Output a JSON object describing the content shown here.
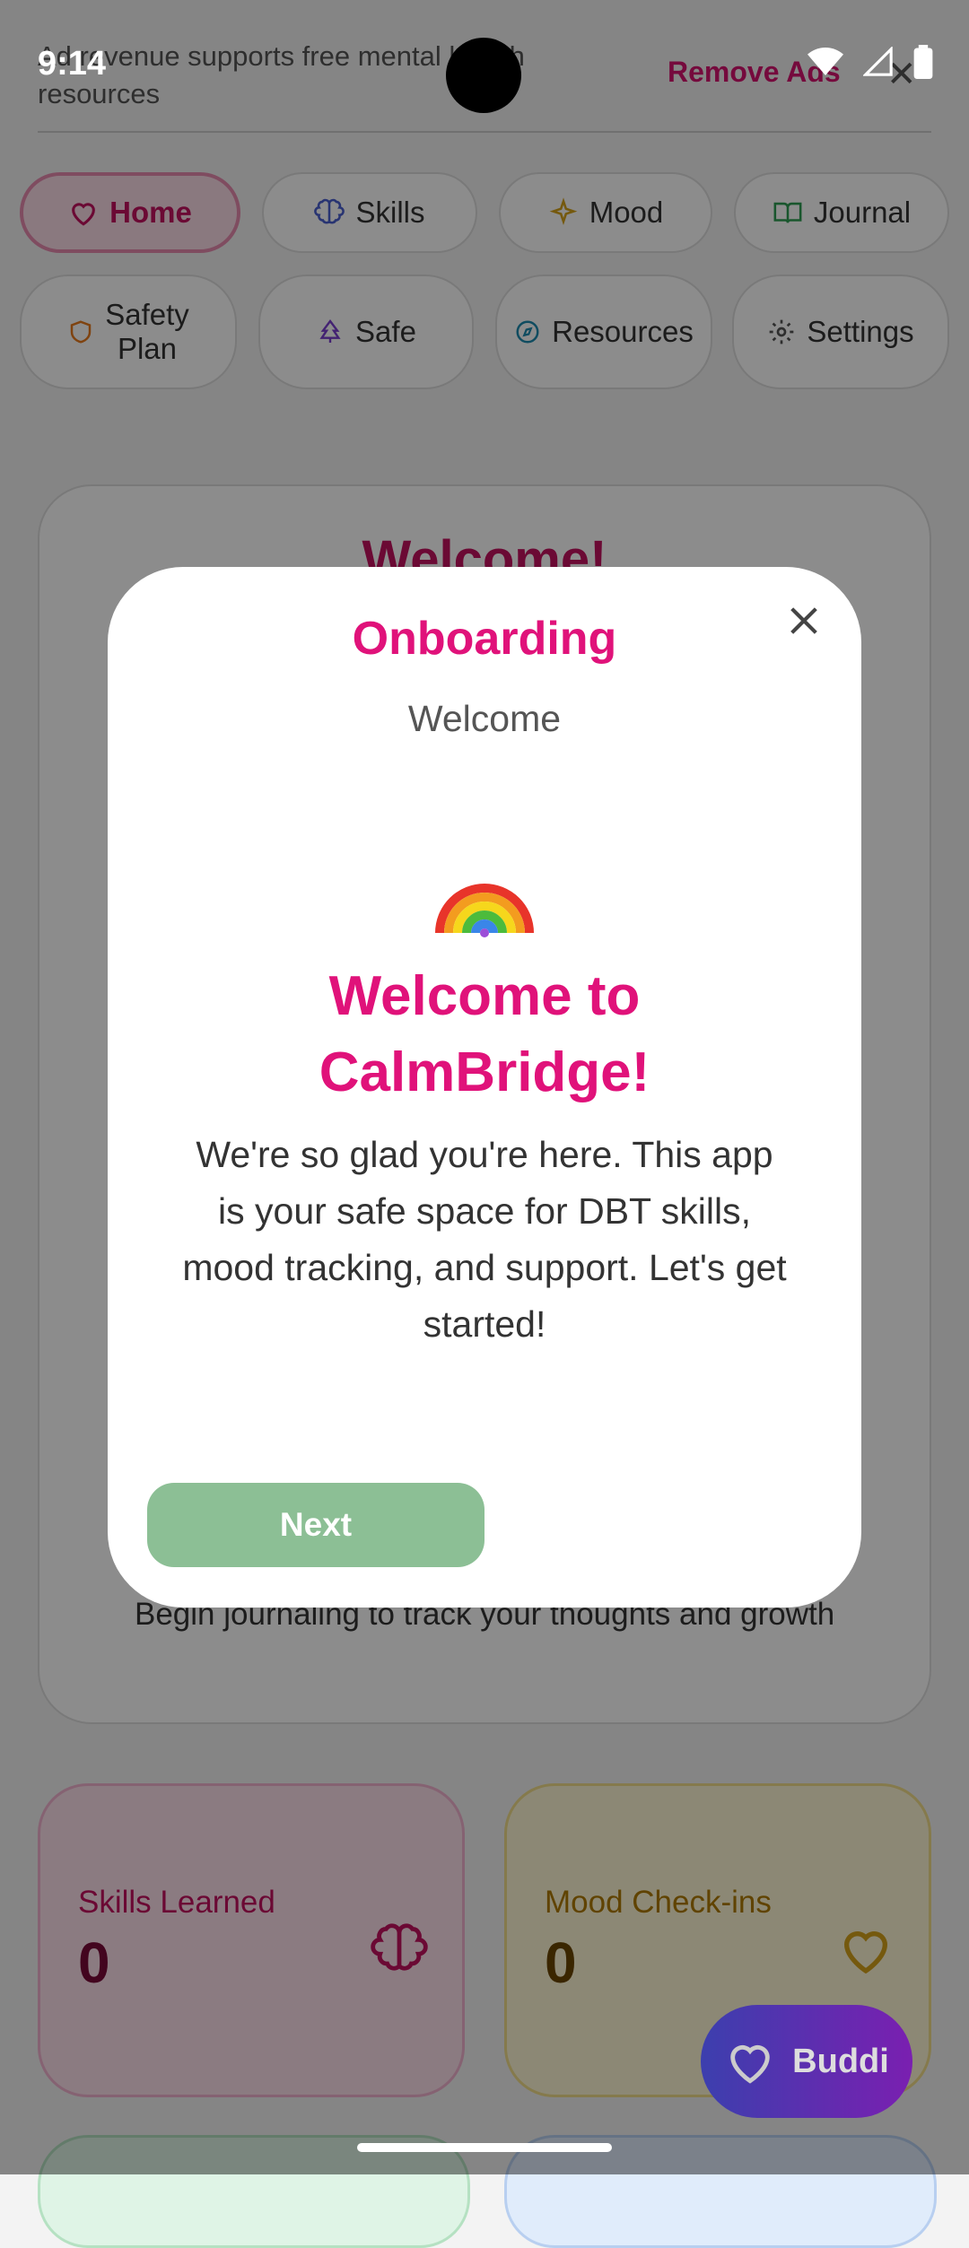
{
  "status": {
    "time": "9:14"
  },
  "ad": {
    "text": "Ad revenue supports free mental health resources",
    "remove_label": "Remove Ads",
    "close_glyph": "✕"
  },
  "nav": {
    "home": "Home",
    "skills": "Skills",
    "mood": "Mood",
    "journal": "Journal",
    "safety_plan_1": "Safety",
    "safety_plan_2": "Plan",
    "safe": "Safe",
    "resources": "Resources",
    "settings": "Settings"
  },
  "background": {
    "title": "Welcome!",
    "journal_hint": "Begin journaling to track your thoughts and growth",
    "stats": {
      "skills_label": "Skills Learned",
      "skills_value": "0",
      "mood_label": "Mood Check-ins",
      "mood_value": "0"
    }
  },
  "modal": {
    "title": "Onboarding",
    "subtitle": "Welcome",
    "emoji": "🌈",
    "heading": "Welcome to CalmBridge!",
    "body": "We're so glad you're here. This app is your safe space for DBT skills, mood tracking, and support. Let's get started!",
    "next_label": "Next"
  },
  "fab": {
    "label": "Buddi"
  },
  "colors": {
    "accent": "#e0127a",
    "next_button": "#8cbf95",
    "fab_start": "#3c3fae",
    "fab_end": "#7a1fb0"
  }
}
